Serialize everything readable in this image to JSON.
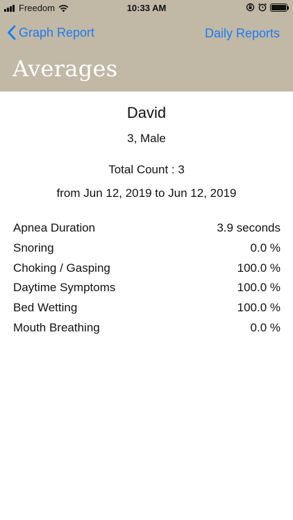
{
  "status_bar": {
    "carrier": "Freedom",
    "time": "10:33 AM",
    "icons": [
      "signal-icon",
      "wifi-icon",
      "orientation-lock-icon",
      "alarm-icon",
      "battery-icon"
    ]
  },
  "nav": {
    "back_label": "Graph Report",
    "right_label": "Daily Reports"
  },
  "title": "Averages",
  "patient": {
    "name": "David",
    "info": "3, Male"
  },
  "total_count": "Total Count : 3",
  "date_range": "from Jun 12, 2019 to Jun 12, 2019",
  "stats": [
    {
      "label": "Apnea Duration",
      "value": "3.9 seconds"
    },
    {
      "label": "Snoring",
      "value": "0.0 %"
    },
    {
      "label": "Choking / Gasping",
      "value": "100.0 %"
    },
    {
      "label": "Daytime Symptoms",
      "value": "100.0 %"
    },
    {
      "label": "Bed Wetting",
      "value": "100.0 %"
    },
    {
      "label": "Mouth Breathing",
      "value": "0.0 %"
    }
  ],
  "colors": {
    "header_bg": "#c2b8a6",
    "link": "#1a7cf0",
    "title_text": "#ffffff"
  }
}
